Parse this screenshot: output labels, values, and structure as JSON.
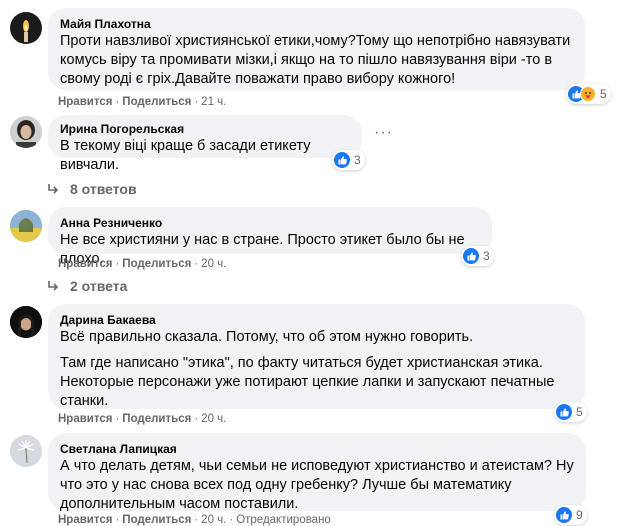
{
  "colors": {
    "like_blue": "#1877f2",
    "bubble_bg": "#f0f2f5",
    "meta_gray": "#65676b"
  },
  "comments": [
    {
      "author": "Майя Плахотна",
      "lines": [
        "Проти навзливої християнської етики,чому?Тому що непотрібно навязувати комусь віру та промивати мізки,і якщо на то пішло навязування віри -то в свому роді є гріх.Давайте поважати право вибору кожного!"
      ],
      "like_label": "Нравится",
      "share_label": "Поделиться",
      "time": "21 ч.",
      "reaction_icons": [
        "like-icon",
        "care-icon"
      ],
      "reaction_count": "5"
    },
    {
      "author": "Ирина Погорельская",
      "lines": [
        "В текому віці краще б засади етикету вивчали."
      ],
      "reaction_icons": [
        "like-icon"
      ],
      "reaction_count": "3",
      "replies_label": "8 ответов",
      "menu_icon": "more-options-icon"
    },
    {
      "author": "Анна Резниченко",
      "lines": [
        "Не все християни у нас в стране. Просто этикет было бы не плохо."
      ],
      "like_label": "Нравится",
      "share_label": "Поделиться",
      "time": "20 ч.",
      "reaction_icons": [
        "like-icon"
      ],
      "reaction_count": "3",
      "replies_label": "2 ответа"
    },
    {
      "author": "Дарина Бакаева",
      "lines": [
        "Всё правильно сказала. Потому, что об этом нужно говорить.",
        "Там где написано \"этика\", по факту читаться будет христианская этика. Некоторые персонажи уже потирают цепкие лапки и запускают печатные станки."
      ],
      "like_label": "Нравится",
      "share_label": "Поделиться",
      "time": "20 ч.",
      "reaction_icons": [
        "like-icon"
      ],
      "reaction_count": "5"
    },
    {
      "author": "Светлана Лапицкая",
      "lines": [
        "А что делать детям, чьи семьи не исповедуют христианство и атеистам? Ну что это у нас снова всех под одну гребенку? Лучше бы математику дополнительным часом поставили."
      ],
      "like_label": "Нравится",
      "share_label": "Поделиться",
      "time": "20 ч.",
      "edited_label": "Отредактировано",
      "reaction_icons": [
        "like-icon"
      ],
      "reaction_count": "9"
    }
  ]
}
